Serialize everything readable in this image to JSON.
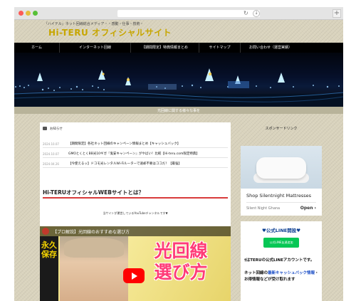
{
  "browser": {
    "reload_icon": "↻",
    "download_icon": "↓",
    "new_tab_icon": "+"
  },
  "header": {
    "tagline": "『ハイテル』ネット回線総合メディア・・感動・仕事・技術・",
    "logo": "Hi-TERU オフィシャルサイト"
  },
  "nav": {
    "items": [
      {
        "label": "ホーム"
      },
      {
        "label": "インターネット回線"
      },
      {
        "label": "【期間限定】特典情報まとめ"
      },
      {
        "label": "サイトマップ"
      },
      {
        "label": "お問い合わせ（運営実績）"
      }
    ]
  },
  "hero": {
    "caption": "光回線に関する様々な事を"
  },
  "news": {
    "heading": "お知らせ",
    "items": [
      {
        "date": "2024.10.07",
        "title": "【期間限定】各社ネット回線のキャンペーン情報まとめ【キャッシュバック】"
      },
      {
        "date": "2024.10.07",
        "title": "GMOとくとくBB光10ギガ『鬼安キャンペーン』がやばい！比較【Hi-teru.com限定特典】"
      },
      {
        "date": "2024.04.26",
        "title": "【今使えるッ】ドコモ光レンタルWi-Fiルーターで速却不要はココだ！【最強】"
      }
    ]
  },
  "about": {
    "title": "Hi-TERUオフィシャルWEBサイトとは？",
    "sub": "当サイトが運営しているYouTubeチャンネルです▼"
  },
  "video": {
    "title": "【プロ解説】光回線のおすすめな選び方",
    "left_text": "永久保存",
    "big_text_1": "光回線",
    "big_text_2": "選び方"
  },
  "sidebar": {
    "sponsor_heading": "スポンサードリンク",
    "ad": {
      "title": "Shop Silentnight Mattresses",
      "brand": "Silent Night Ghana",
      "open_label": "Open",
      "open_icon": "›"
    },
    "line": {
      "title": "♥公式LINE開設♥",
      "button_label": "公式LINE友達追加",
      "text1": "†はTERUの公式LINEアカウントです。",
      "text2_pre": "ネット回線の",
      "text2_link": "最新キャッシュバック情報",
      "text2_post": "・お得情報などが受け取れます"
    }
  }
}
